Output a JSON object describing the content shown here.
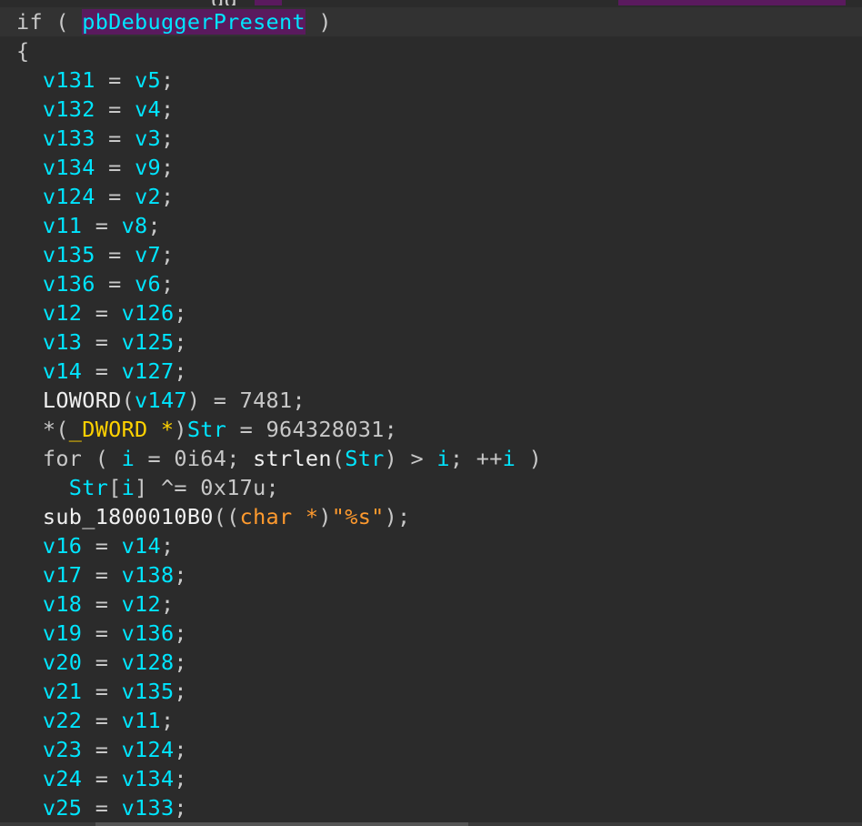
{
  "editor": {
    "top_clip_text": "gg",
    "lines": [
      {
        "tokens": [
          {
            "t": "if ( ",
            "c": "kw"
          },
          {
            "t": "pbDebuggerPresent",
            "c": "hl"
          },
          {
            "t": " )",
            "c": "op"
          }
        ]
      },
      {
        "tokens": [
          {
            "t": "{",
            "c": "op"
          }
        ]
      },
      {
        "tokens": [
          {
            "t": "  v131",
            "c": "id"
          },
          {
            "t": " = ",
            "c": "op"
          },
          {
            "t": "v5",
            "c": "id"
          },
          {
            "t": ";",
            "c": "op"
          }
        ]
      },
      {
        "tokens": [
          {
            "t": "  v132",
            "c": "id"
          },
          {
            "t": " = ",
            "c": "op"
          },
          {
            "t": "v4",
            "c": "id"
          },
          {
            "t": ";",
            "c": "op"
          }
        ]
      },
      {
        "tokens": [
          {
            "t": "  v133",
            "c": "id"
          },
          {
            "t": " = ",
            "c": "op"
          },
          {
            "t": "v3",
            "c": "id"
          },
          {
            "t": ";",
            "c": "op"
          }
        ]
      },
      {
        "tokens": [
          {
            "t": "  v134",
            "c": "id"
          },
          {
            "t": " = ",
            "c": "op"
          },
          {
            "t": "v9",
            "c": "id"
          },
          {
            "t": ";",
            "c": "op"
          }
        ]
      },
      {
        "tokens": [
          {
            "t": "  v124",
            "c": "id"
          },
          {
            "t": " = ",
            "c": "op"
          },
          {
            "t": "v2",
            "c": "id"
          },
          {
            "t": ";",
            "c": "op"
          }
        ]
      },
      {
        "tokens": [
          {
            "t": "  v11",
            "c": "id"
          },
          {
            "t": " = ",
            "c": "op"
          },
          {
            "t": "v8",
            "c": "id"
          },
          {
            "t": ";",
            "c": "op"
          }
        ]
      },
      {
        "tokens": [
          {
            "t": "  v135",
            "c": "id"
          },
          {
            "t": " = ",
            "c": "op"
          },
          {
            "t": "v7",
            "c": "id"
          },
          {
            "t": ";",
            "c": "op"
          }
        ]
      },
      {
        "tokens": [
          {
            "t": "  v136",
            "c": "id"
          },
          {
            "t": " = ",
            "c": "op"
          },
          {
            "t": "v6",
            "c": "id"
          },
          {
            "t": ";",
            "c": "op"
          }
        ]
      },
      {
        "tokens": [
          {
            "t": "  v12",
            "c": "id"
          },
          {
            "t": " = ",
            "c": "op"
          },
          {
            "t": "v126",
            "c": "id"
          },
          {
            "t": ";",
            "c": "op"
          }
        ]
      },
      {
        "tokens": [
          {
            "t": "  v13",
            "c": "id"
          },
          {
            "t": " = ",
            "c": "op"
          },
          {
            "t": "v125",
            "c": "id"
          },
          {
            "t": ";",
            "c": "op"
          }
        ]
      },
      {
        "tokens": [
          {
            "t": "  v14",
            "c": "id"
          },
          {
            "t": " = ",
            "c": "op"
          },
          {
            "t": "v127",
            "c": "id"
          },
          {
            "t": ";",
            "c": "op"
          }
        ]
      },
      {
        "tokens": [
          {
            "t": "  LOWORD",
            "c": "fn"
          },
          {
            "t": "(",
            "c": "op"
          },
          {
            "t": "v147",
            "c": "id"
          },
          {
            "t": ") = ",
            "c": "op"
          },
          {
            "t": "7481",
            "c": "num"
          },
          {
            "t": ";",
            "c": "op"
          }
        ]
      },
      {
        "tokens": [
          {
            "t": "  *(",
            "c": "op"
          },
          {
            "t": "_DWORD *",
            "c": "type"
          },
          {
            "t": ")",
            "c": "op"
          },
          {
            "t": "Str",
            "c": "id"
          },
          {
            "t": " = ",
            "c": "op"
          },
          {
            "t": "964328031",
            "c": "num"
          },
          {
            "t": ";",
            "c": "op"
          }
        ]
      },
      {
        "tokens": [
          {
            "t": "  for ( ",
            "c": "kw"
          },
          {
            "t": "i",
            "c": "id"
          },
          {
            "t": " = ",
            "c": "op"
          },
          {
            "t": "0i64",
            "c": "num"
          },
          {
            "t": "; ",
            "c": "op"
          },
          {
            "t": "strlen",
            "c": "fn"
          },
          {
            "t": "(",
            "c": "op"
          },
          {
            "t": "Str",
            "c": "id"
          },
          {
            "t": ") > ",
            "c": "op"
          },
          {
            "t": "i",
            "c": "id"
          },
          {
            "t": "; ++",
            "c": "op"
          },
          {
            "t": "i",
            "c": "id"
          },
          {
            "t": " )",
            "c": "op"
          }
        ]
      },
      {
        "tokens": [
          {
            "t": "    Str",
            "c": "id"
          },
          {
            "t": "[",
            "c": "op"
          },
          {
            "t": "i",
            "c": "id"
          },
          {
            "t": "] ^= ",
            "c": "op"
          },
          {
            "t": "0x17u",
            "c": "num"
          },
          {
            "t": ";",
            "c": "op"
          }
        ]
      },
      {
        "tokens": [
          {
            "t": "  sub_1800010B0",
            "c": "fn"
          },
          {
            "t": "((",
            "c": "op"
          },
          {
            "t": "char *",
            "c": "str"
          },
          {
            "t": ")",
            "c": "op"
          },
          {
            "t": "\"%s\"",
            "c": "str"
          },
          {
            "t": ");",
            "c": "op"
          }
        ]
      },
      {
        "tokens": [
          {
            "t": "  v16",
            "c": "id"
          },
          {
            "t": " = ",
            "c": "op"
          },
          {
            "t": "v14",
            "c": "id"
          },
          {
            "t": ";",
            "c": "op"
          }
        ]
      },
      {
        "tokens": [
          {
            "t": "  v17",
            "c": "id"
          },
          {
            "t": " = ",
            "c": "op"
          },
          {
            "t": "v138",
            "c": "id"
          },
          {
            "t": ";",
            "c": "op"
          }
        ]
      },
      {
        "tokens": [
          {
            "t": "  v18",
            "c": "id"
          },
          {
            "t": " = ",
            "c": "op"
          },
          {
            "t": "v12",
            "c": "id"
          },
          {
            "t": ";",
            "c": "op"
          }
        ]
      },
      {
        "tokens": [
          {
            "t": "  v19",
            "c": "id"
          },
          {
            "t": " = ",
            "c": "op"
          },
          {
            "t": "v136",
            "c": "id"
          },
          {
            "t": ";",
            "c": "op"
          }
        ]
      },
      {
        "tokens": [
          {
            "t": "  v20",
            "c": "id"
          },
          {
            "t": " = ",
            "c": "op"
          },
          {
            "t": "v128",
            "c": "id"
          },
          {
            "t": ";",
            "c": "op"
          }
        ]
      },
      {
        "tokens": [
          {
            "t": "  v21",
            "c": "id"
          },
          {
            "t": " = ",
            "c": "op"
          },
          {
            "t": "v135",
            "c": "id"
          },
          {
            "t": ";",
            "c": "op"
          }
        ]
      },
      {
        "tokens": [
          {
            "t": "  v22",
            "c": "id"
          },
          {
            "t": " = ",
            "c": "op"
          },
          {
            "t": "v11",
            "c": "id"
          },
          {
            "t": ";",
            "c": "op"
          }
        ]
      },
      {
        "tokens": [
          {
            "t": "  v23",
            "c": "id"
          },
          {
            "t": " = ",
            "c": "op"
          },
          {
            "t": "v124",
            "c": "id"
          },
          {
            "t": ";",
            "c": "op"
          }
        ]
      },
      {
        "tokens": [
          {
            "t": "  v24",
            "c": "id"
          },
          {
            "t": " = ",
            "c": "op"
          },
          {
            "t": "v134",
            "c": "id"
          },
          {
            "t": ";",
            "c": "op"
          }
        ]
      },
      {
        "tokens": [
          {
            "t": "  v25",
            "c": "id"
          },
          {
            "t": " = ",
            "c": "op"
          },
          {
            "t": "v133",
            "c": "id"
          },
          {
            "t": ";",
            "c": "op"
          }
        ]
      }
    ]
  },
  "colors": {
    "background": "#2b2b2b",
    "identifier": "#00e5ff",
    "keyword": "#c8c8c8",
    "type": "#ffd200",
    "string": "#ff9a2e",
    "highlight": "#5a1a5e"
  }
}
